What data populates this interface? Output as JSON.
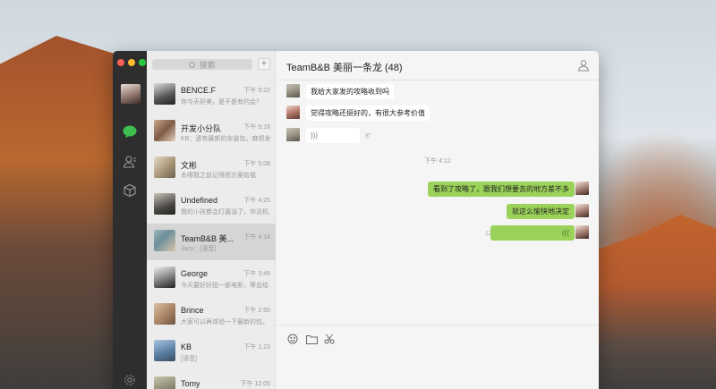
{
  "search": {
    "placeholder": "搜索"
  },
  "chats": [
    {
      "name": "BENCE.F",
      "time": "下午 5:22",
      "preview": "你今天好美，是不是有约会？",
      "avatar_color": "#3a3a3a"
    },
    {
      "name": "开发小分队",
      "time": "下午 5:16",
      "preview": "KB：遗有最新的安装包，麻烦发...",
      "avatar_color": "#a07c62"
    },
    {
      "name": "文彬",
      "time": "下午 5:08",
      "preview": "去哪我之前记得把方案给我",
      "avatar_color": "#c2b59a"
    },
    {
      "name": "Undefined",
      "time": "下午 4:25",
      "preview": "我的小孩都会打酱油了，你没机...",
      "avatar_color": "#4c4a46"
    },
    {
      "name": "TeamB&B 美...",
      "time": "下午 4:14",
      "preview": "Jacy：[语音]",
      "avatar_color": "#6b8f9a"
    },
    {
      "name": "George",
      "time": "下午 3:46",
      "preview": "今天要好好拍一部电影，等会给...",
      "avatar_color": "#2c2c2c"
    },
    {
      "name": "Brince",
      "time": "下午 2:50",
      "preview": "大家可以再体验一下最新的包。",
      "avatar_color": "#b08868"
    },
    {
      "name": "KB",
      "time": "下午 1:23",
      "preview": "[语音]",
      "avatar_color": "#5b7fa3"
    },
    {
      "name": "Tomy",
      "time": "下午 12:05",
      "preview": "",
      "avatar_color": "#8b8b73"
    }
  ],
  "conversation": {
    "title": "TeamB&B 美丽一条龙 (48)",
    "messages_in": [
      {
        "text": "我给大家发的攻略收到吗"
      },
      {
        "text": "觉得攻略还挺好的，有很大参考价值"
      },
      {
        "text": "",
        "duration": "8\""
      }
    ],
    "timestamp": "下午 4:12",
    "messages_out": [
      {
        "text": "看到了攻略了，跟我们想要去的地方差不多"
      },
      {
        "text": "就这么愉快地决定"
      },
      {
        "text": "",
        "duration": "12\""
      }
    ]
  },
  "colors": {
    "accent": "#9bd25a",
    "sidebar_bg": "#2e2e2e",
    "list_bg": "#ececec",
    "active_item": "#d5d5d5"
  }
}
